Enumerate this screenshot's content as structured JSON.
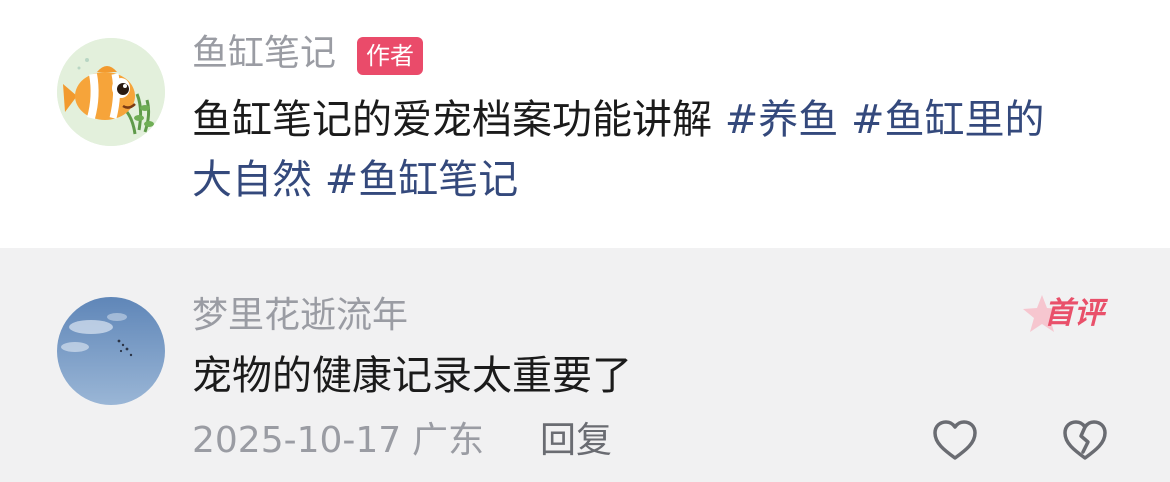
{
  "post": {
    "author_name": "鱼缸笔记",
    "author_badge": "作者",
    "text": "鱼缸笔记的爱宠档案功能讲解",
    "tags": [
      "#养鱼",
      "#鱼缸里的",
      "大自然",
      "#鱼缸笔记"
    ]
  },
  "comment": {
    "user_name": "梦里花逝流年",
    "badge": "首评",
    "text": "宠物的健康记录太重要了",
    "date": "2025-10-17",
    "region": "广东",
    "reply_label": "回复",
    "like_icon": "heart-outline-icon",
    "dislike_icon": "broken-heart-icon"
  },
  "colors": {
    "tag": "#34497c",
    "author_badge": "#ea4b6a",
    "first_badge": "#e9506a",
    "comment_bg": "#f1f1f2"
  }
}
